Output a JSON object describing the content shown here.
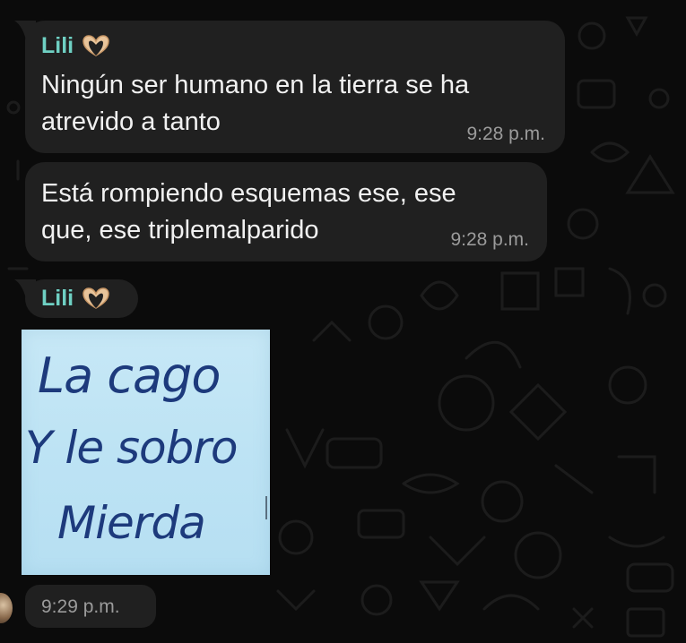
{
  "chat": {
    "messages": [
      {
        "sender": "Lili",
        "sender_icon": "heart-hands-icon",
        "text": "Ningún ser humano en la tierra se ha\natrevido a tanto",
        "time": "9:28 p.m."
      },
      {
        "text": "Está rompiendo esquemas ese, ese\nque, ese triplemalparido",
        "time": "9:28 p.m."
      },
      {
        "sender": "Lili",
        "sender_icon": "heart-hands-icon",
        "type": "sticker"
      },
      {
        "time": "9:29 p.m."
      }
    ],
    "sticker": {
      "lines": [
        "La cago",
        "Y le sobro",
        "Mierda"
      ]
    }
  },
  "colors": {
    "background": "#0b0b0b",
    "bubble": "#202020",
    "sender_name": "#6fd0c3",
    "timestamp": "#9b9b9b",
    "sticker_bg": "#c0e4f5",
    "sticker_text": "#1d3a7c"
  }
}
